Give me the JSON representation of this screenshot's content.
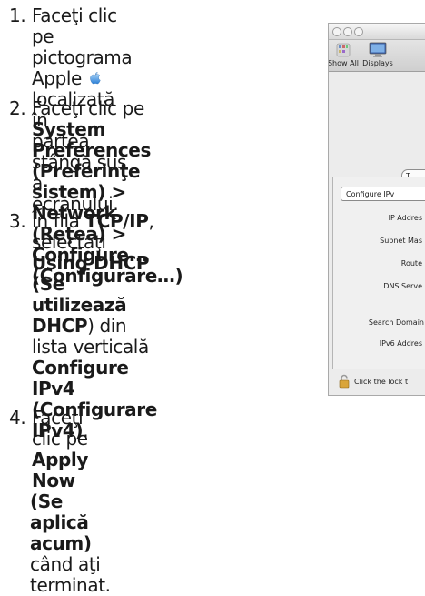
{
  "steps": [
    {
      "num": "1.",
      "lines": [
        "Faceţi clic pe pictograma",
        "Apple",
        "localizată în",
        "partea stângă sus a",
        "ecranului."
      ]
    },
    {
      "num": "2.",
      "lines": [
        "Faceţi clic pe ",
        "System",
        "Preferences (Preferinţe",
        "sistem) > Network",
        "(Reţea) > Configure...",
        "(Configurare…)"
      ]
    },
    {
      "num": "3.",
      "lines": [
        "În fila ",
        "TCP/IP",
        ", selectaţi",
        "Using DHCP (Se",
        "utilizează DHCP",
        ") din",
        "lista verticală ",
        "Configure",
        "IPv4 (Configurare IPv4)",
        "."
      ]
    },
    {
      "num": "4.",
      "lines": [
        "Faceţi clic pe ",
        "Apply Now",
        "(Se aplică acum)",
        " când aţi terminat."
      ]
    }
  ],
  "screenshot": {
    "toolbar": [
      "Show All",
      "Displays"
    ],
    "tab_label": "T",
    "configure_label": "Configure IPv",
    "rows": [
      "IP Addres",
      "Subnet Mas",
      "Route",
      "DNS Serve",
      "Search Domain",
      "IPv6 Addres"
    ],
    "lock_text": "Click the lock t"
  }
}
